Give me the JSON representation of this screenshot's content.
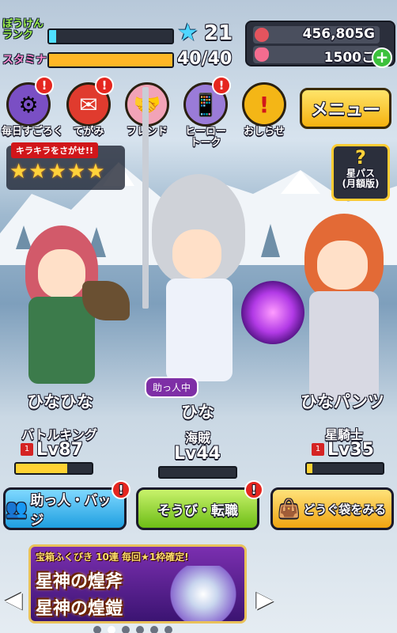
{
  "header": {
    "rank_label": "ぼうけんランク",
    "rank_value": "21",
    "rank_progress": 0.06,
    "stamina_label": "スタミナ",
    "stamina_value": "40/40",
    "stamina_progress": 1.0,
    "gold": "456,805G",
    "gems": "1500こ",
    "plus_label": "+"
  },
  "icons": [
    {
      "label": "毎日すごろく",
      "badge": "!",
      "icon": "dice-wheel-icon",
      "color": "#7a4fc4"
    },
    {
      "label": "てがみ",
      "badge": "!",
      "icon": "mailbox-icon",
      "color": "#e03b2e"
    },
    {
      "label": "フレンド",
      "badge": "",
      "icon": "handshake-icon",
      "color": "#f2a3b7"
    },
    {
      "label": "ヒーロートーク",
      "badge": "!",
      "icon": "phone-icon",
      "color": "#9a7bd8"
    },
    {
      "label": "おしらせ",
      "badge": "",
      "icon": "exclamation-icon",
      "color": "#f4b616"
    }
  ],
  "menu_label": "メニュー",
  "kira": {
    "title": "キラキラをさがせ!!",
    "stars": "★★★★★"
  },
  "starpass": {
    "q": "?",
    "line1": "星パス",
    "line2": "(月額版)"
  },
  "characters": [
    {
      "name": "ひなひな",
      "job": "バトルキング",
      "level": "Lv87",
      "lv_progress": 0.68,
      "hair": "#d25a6a",
      "outfit": "#3c7b4b"
    },
    {
      "name": "ひな",
      "job": "海賊",
      "level": "Lv44",
      "lv_progress": 0.0,
      "hair": "#cfd2d8",
      "outfit": "#eef2fa",
      "helping": "助っ人中"
    },
    {
      "name": "ひなパンツ",
      "job": "星騎士",
      "level": "Lv35",
      "lv_progress": 0.07,
      "hair": "#e36a36",
      "outfit": "#d8d9e3"
    }
  ],
  "buttons": {
    "helper": "助っ人・バッジ",
    "equip": "そうび・転職",
    "items": "どうぐ袋をみる",
    "badge": "!"
  },
  "banner": {
    "top": "宝箱ふくびき 10連 毎回★1枠確定!",
    "line1": "星神の煌斧",
    "line2": "星神の煌鎧"
  },
  "colors": {
    "helper_btn": "#39b6ef",
    "equip_btn": "#96d934",
    "items_btn": "#f5b521",
    "accent_gold": "#ffd233"
  }
}
